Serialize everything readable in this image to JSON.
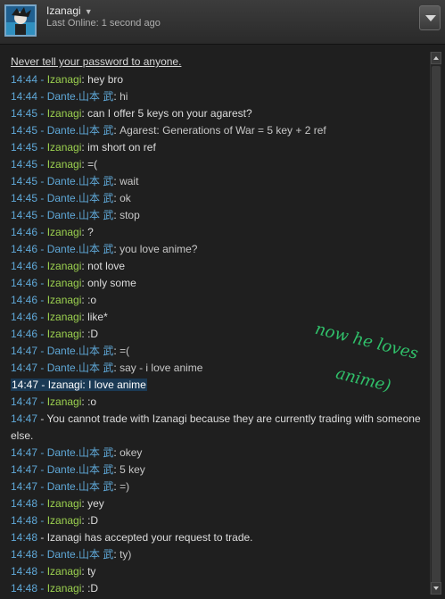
{
  "header": {
    "user_name": "Izanagi",
    "status": "Last Online: 1 second ago"
  },
  "warning": "Never tell your password to anyone.",
  "messages": [
    {
      "time": "14:44",
      "user": "Izanagi",
      "text": "hey bro"
    },
    {
      "time": "14:44",
      "user": "Dante.山本 武",
      "text": "hi"
    },
    {
      "time": "14:45",
      "user": "Izanagi",
      "text": "can I offer 5 keys on your agarest?"
    },
    {
      "time": "14:45",
      "user": "Dante.山本 武",
      "text": "Agarest: Generations of War = 5 key + 2 ref"
    },
    {
      "time": "14:45",
      "user": "Izanagi",
      "text": "im short on ref"
    },
    {
      "time": "14:45",
      "user": "Izanagi",
      "text": "=("
    },
    {
      "time": "14:45",
      "user": "Dante.山本 武",
      "text": "wait"
    },
    {
      "time": "14:45",
      "user": "Dante.山本 武",
      "text": "ok"
    },
    {
      "time": "14:45",
      "user": "Dante.山本 武",
      "text": "stop"
    },
    {
      "time": "14:46",
      "user": "Izanagi",
      "text": "?"
    },
    {
      "time": "14:46",
      "user": "Dante.山本 武",
      "text": "you love anime?"
    },
    {
      "time": "14:46",
      "user": "Izanagi",
      "text": "not love"
    },
    {
      "time": "14:46",
      "user": "Izanagi",
      "text": "only some"
    },
    {
      "time": "14:46",
      "user": "Izanagi",
      "text": ":o"
    },
    {
      "time": "14:46",
      "user": "Izanagi",
      "text": "like*"
    },
    {
      "time": "14:46",
      "user": "Izanagi",
      "text": ":D"
    },
    {
      "time": "14:47",
      "user": "Dante.山本 武",
      "text": "=("
    },
    {
      "time": "14:47",
      "user": "Dante.山本 武",
      "text": "say - i love anime"
    },
    {
      "time": "14:47",
      "user": "Izanagi",
      "text": "I love anime",
      "highlight": true
    },
    {
      "time": "14:47",
      "user": "Izanagi",
      "text": ":o"
    },
    {
      "time": "14:47",
      "system": true,
      "text": "You cannot trade with  Izanagi  because they are currently trading with someone else."
    },
    {
      "time": "14:47",
      "user": "Dante.山本 武",
      "text": "okey"
    },
    {
      "time": "14:47",
      "user": "Dante.山本 武",
      "text": "5 key"
    },
    {
      "time": "14:47",
      "user": "Dante.山本 武",
      "text": "=)"
    },
    {
      "time": "14:48",
      "user": "Izanagi",
      "text": "yey"
    },
    {
      "time": "14:48",
      "user": "Izanagi",
      "text": ":D"
    },
    {
      "time": "14:48",
      "system": true,
      "text": "Izanagi has accepted your request to trade."
    },
    {
      "time": "14:48",
      "user": "Dante.山本 武",
      "text": "ty)"
    },
    {
      "time": "14:48",
      "user": "Izanagi",
      "text": "ty"
    },
    {
      "time": "14:48",
      "user": "Izanagi",
      "text": ":D"
    }
  ],
  "annotation": {
    "line1": "now he loves",
    "line2": "anime)"
  }
}
